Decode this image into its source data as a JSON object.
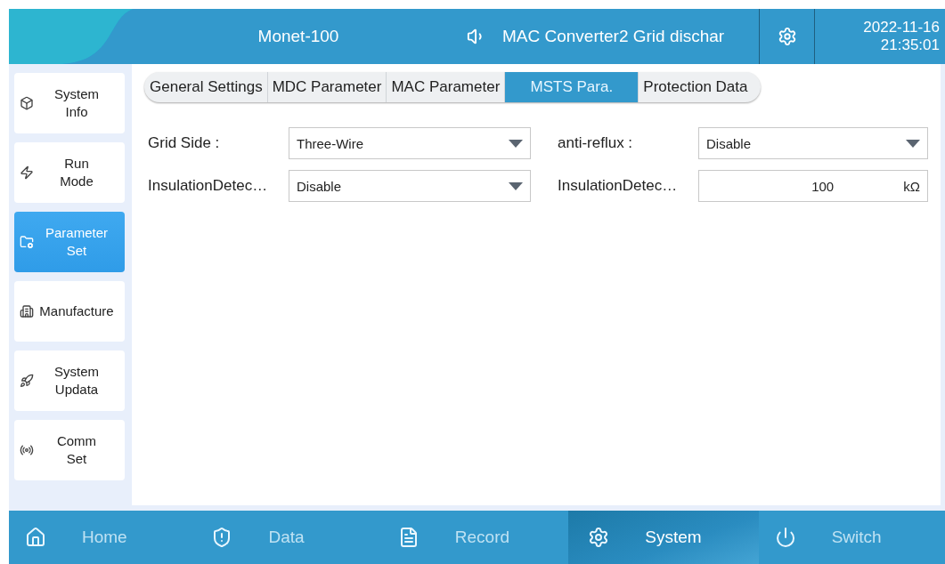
{
  "header": {
    "title": "Monet-100",
    "message": "MAC Converter2 Grid dischar",
    "date": "2022-11-16",
    "time": "21:35:01"
  },
  "sidebar": {
    "items": [
      {
        "label": "System\nInfo",
        "selected": false
      },
      {
        "label": "Run\nMode",
        "selected": false
      },
      {
        "label": "Parameter\nSet",
        "selected": true
      },
      {
        "label": "Manufacture",
        "selected": false
      },
      {
        "label": "System\nUpdata",
        "selected": false
      },
      {
        "label": "Comm\nSet",
        "selected": false
      }
    ]
  },
  "tabs": [
    {
      "label": "General Settings",
      "selected": false
    },
    {
      "label": "MDC Parameter",
      "selected": false
    },
    {
      "label": "MAC Parameter",
      "selected": false
    },
    {
      "label": "MSTS Para.",
      "selected": true
    },
    {
      "label": "Protection Data",
      "selected": false
    }
  ],
  "fields": [
    {
      "label": "Grid Side :",
      "kind": "select",
      "value": "Three-Wire"
    },
    {
      "label": "anti-reflux :",
      "kind": "select",
      "value": "Disable"
    },
    {
      "label": "InsulationDetec…",
      "kind": "select",
      "value": "Disable"
    },
    {
      "label": "InsulationDetec…",
      "kind": "input",
      "value": "100",
      "unit": "kΩ"
    }
  ],
  "bottom_nav": [
    {
      "label": "Home",
      "selected": false
    },
    {
      "label": "Data",
      "selected": false
    },
    {
      "label": "Record",
      "selected": false
    },
    {
      "label": "System",
      "selected": true
    },
    {
      "label": "Switch",
      "selected": false
    }
  ]
}
